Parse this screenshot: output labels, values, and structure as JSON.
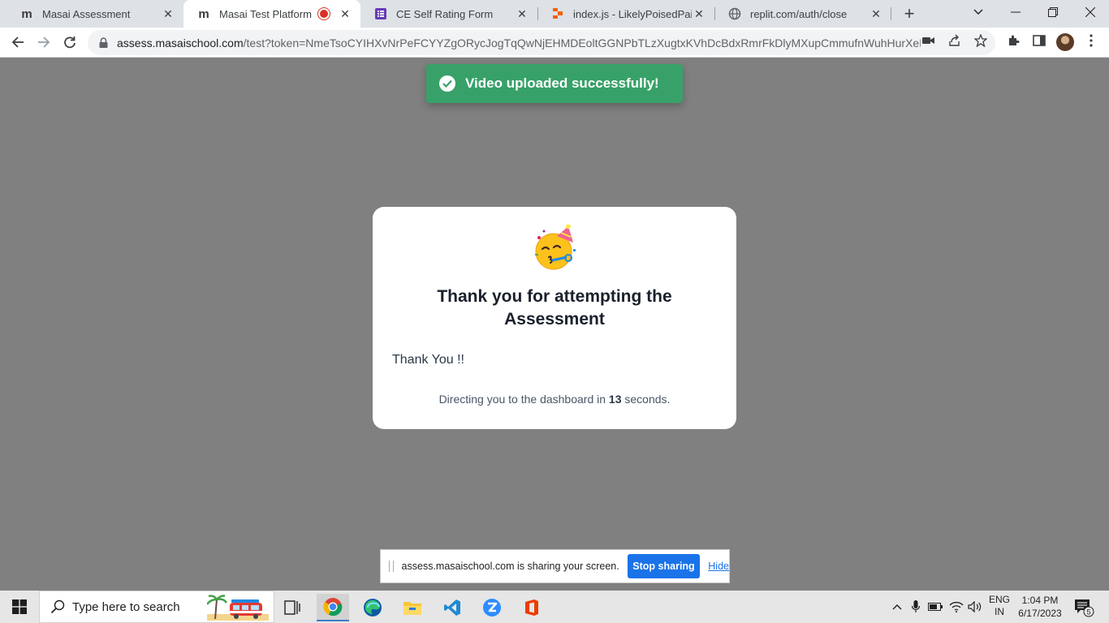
{
  "browser": {
    "tabs": [
      {
        "title": "Masai Assessment",
        "icon": "masai-m-icon"
      },
      {
        "title": "Masai Test Platform",
        "icon": "masai-m-icon",
        "recording": true
      },
      {
        "title": "CE Self Rating Form",
        "icon": "forms-icon"
      },
      {
        "title": "index.js - LikelyPoisedPaint -",
        "icon": "replit-icon"
      },
      {
        "title": "replit.com/auth/close",
        "icon": "globe-icon"
      }
    ],
    "logo_letter": "m",
    "url_host": "assess.masaischool.com",
    "url_rest": "/test?token=NmeTsoCYIHXvNrPeFCYYZgORycJogTqQwNjEHMDEoltGGNPbTLzXugtxKVhDcBdxRmrFkDlyMXupCmmufnWuhHurXeEVP..."
  },
  "toast": {
    "message": "Video uploaded successfully!",
    "color": "#38a169"
  },
  "modal": {
    "title": "Thank you for attempting the Assessment",
    "body": "Thank You !!",
    "redirect_prefix": "Directing you to the dashboard in ",
    "redirect_seconds": "13",
    "redirect_suffix": " seconds."
  },
  "share_bar": {
    "text": "assess.masaischool.com is sharing your screen.",
    "stop_label": "Stop sharing",
    "hide_label": "Hide"
  },
  "taskbar": {
    "search_placeholder": "Type here to search",
    "language_line1": "ENG",
    "language_line2": "IN",
    "time": "1:04 PM",
    "date": "6/17/2023",
    "notification_count": "5"
  }
}
